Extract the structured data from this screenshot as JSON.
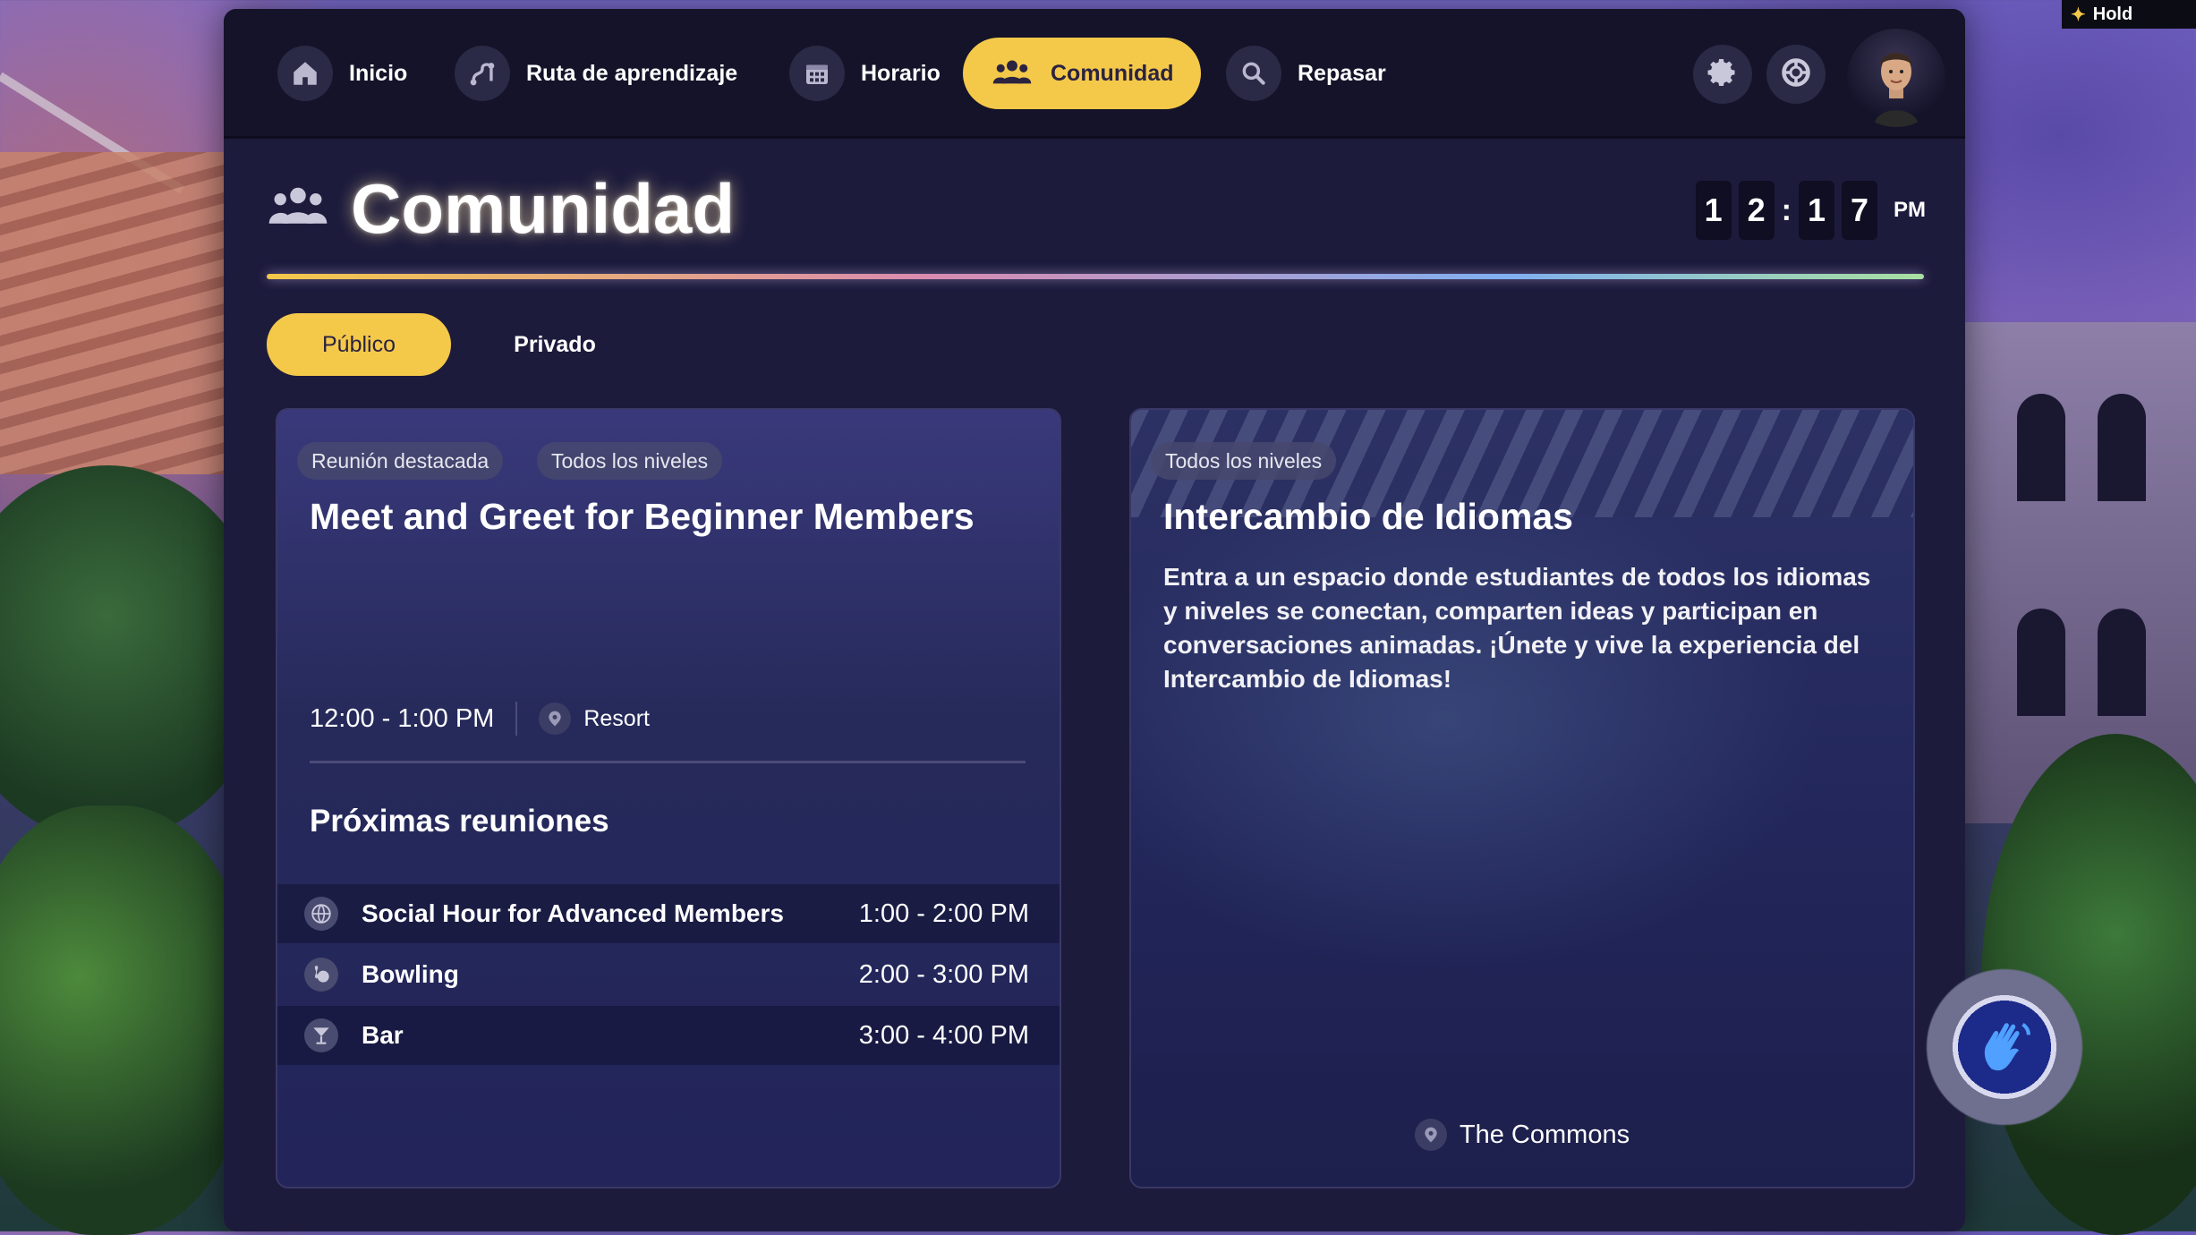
{
  "nav": {
    "items": [
      {
        "label": "Inicio",
        "icon": "home-icon"
      },
      {
        "label": "Ruta de aprendizaje",
        "icon": "route-icon"
      },
      {
        "label": "Horario",
        "icon": "calendar-icon"
      },
      {
        "label": "Comunidad",
        "icon": "people-icon",
        "active": true
      },
      {
        "label": "Repasar",
        "icon": "magnifier-icon"
      }
    ],
    "settings_icon": "gear-icon",
    "help_icon": "lifebuoy-icon"
  },
  "header": {
    "title": "Comunidad",
    "clock": {
      "digits": [
        "1",
        "2",
        "1",
        "7"
      ],
      "separator": ":",
      "ampm": "PM"
    }
  },
  "tabs": [
    {
      "label": "Público",
      "active": true
    },
    {
      "label": "Privado",
      "active": false
    }
  ],
  "featured": {
    "tags": [
      "Reunión destacada",
      "Todos los niveles"
    ],
    "title": "Meet and Greet for Beginner Members",
    "time": "12:00 - 1:00 PM",
    "location": "Resort",
    "upcoming_title": "Próximas reuniones",
    "upcoming": [
      {
        "name": "Social Hour for Advanced Members",
        "time": "1:00 - 2:00 PM",
        "icon": "globe-icon"
      },
      {
        "name": "Bowling",
        "time": "2:00 - 3:00 PM",
        "icon": "bowling-icon"
      },
      {
        "name": "Bar",
        "time": "3:00 - 4:00 PM",
        "icon": "cocktail-icon"
      }
    ]
  },
  "exchange": {
    "tag": "Todos los niveles",
    "title": "Intercambio de Idiomas",
    "description": "Entra a un espacio donde estudiantes de todos los idiomas y niveles se conectan, comparten ideas y participan en conversaciones animadas. ¡Únete y vive la experiencia del Intercambio de Idiomas!",
    "location": "The Commons"
  },
  "overlay": {
    "hold_label": "Hold",
    "wave_icon": "wave-hand-icon"
  },
  "colors": {
    "accent": "#f4c94a",
    "panel": "#1d1b3c",
    "navbar": "#141329"
  }
}
